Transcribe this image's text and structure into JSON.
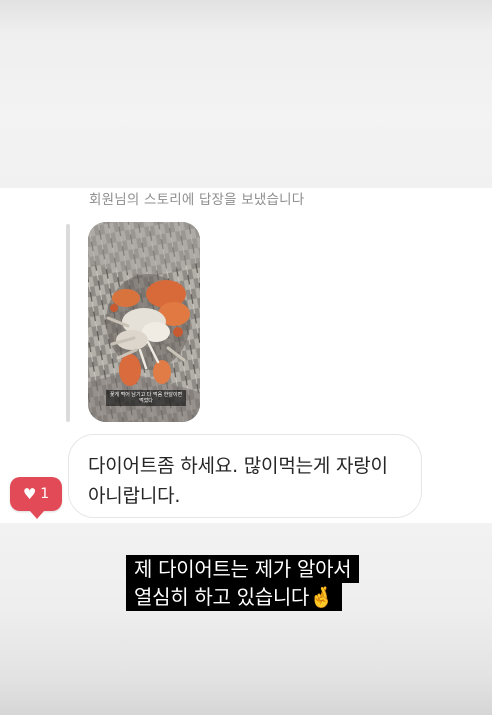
{
  "thread": {
    "reply_note": "회원님의 스토리에 답장을 보냈습니다",
    "story_caption": "꽃게 먹어 남기고 다 먹음 한달이면 먹었다"
  },
  "message": {
    "line1": "다이어트좀 하세요. 많이먹는게 자랑이",
    "line2": "아니랍니다.",
    "likes": {
      "icon": "heart-icon",
      "count": "1",
      "color": "#e34a57"
    }
  },
  "overlay": {
    "line1": "제 다이어트는 제가 알아서",
    "line2": "열심히 하고 있습니다🤞"
  }
}
